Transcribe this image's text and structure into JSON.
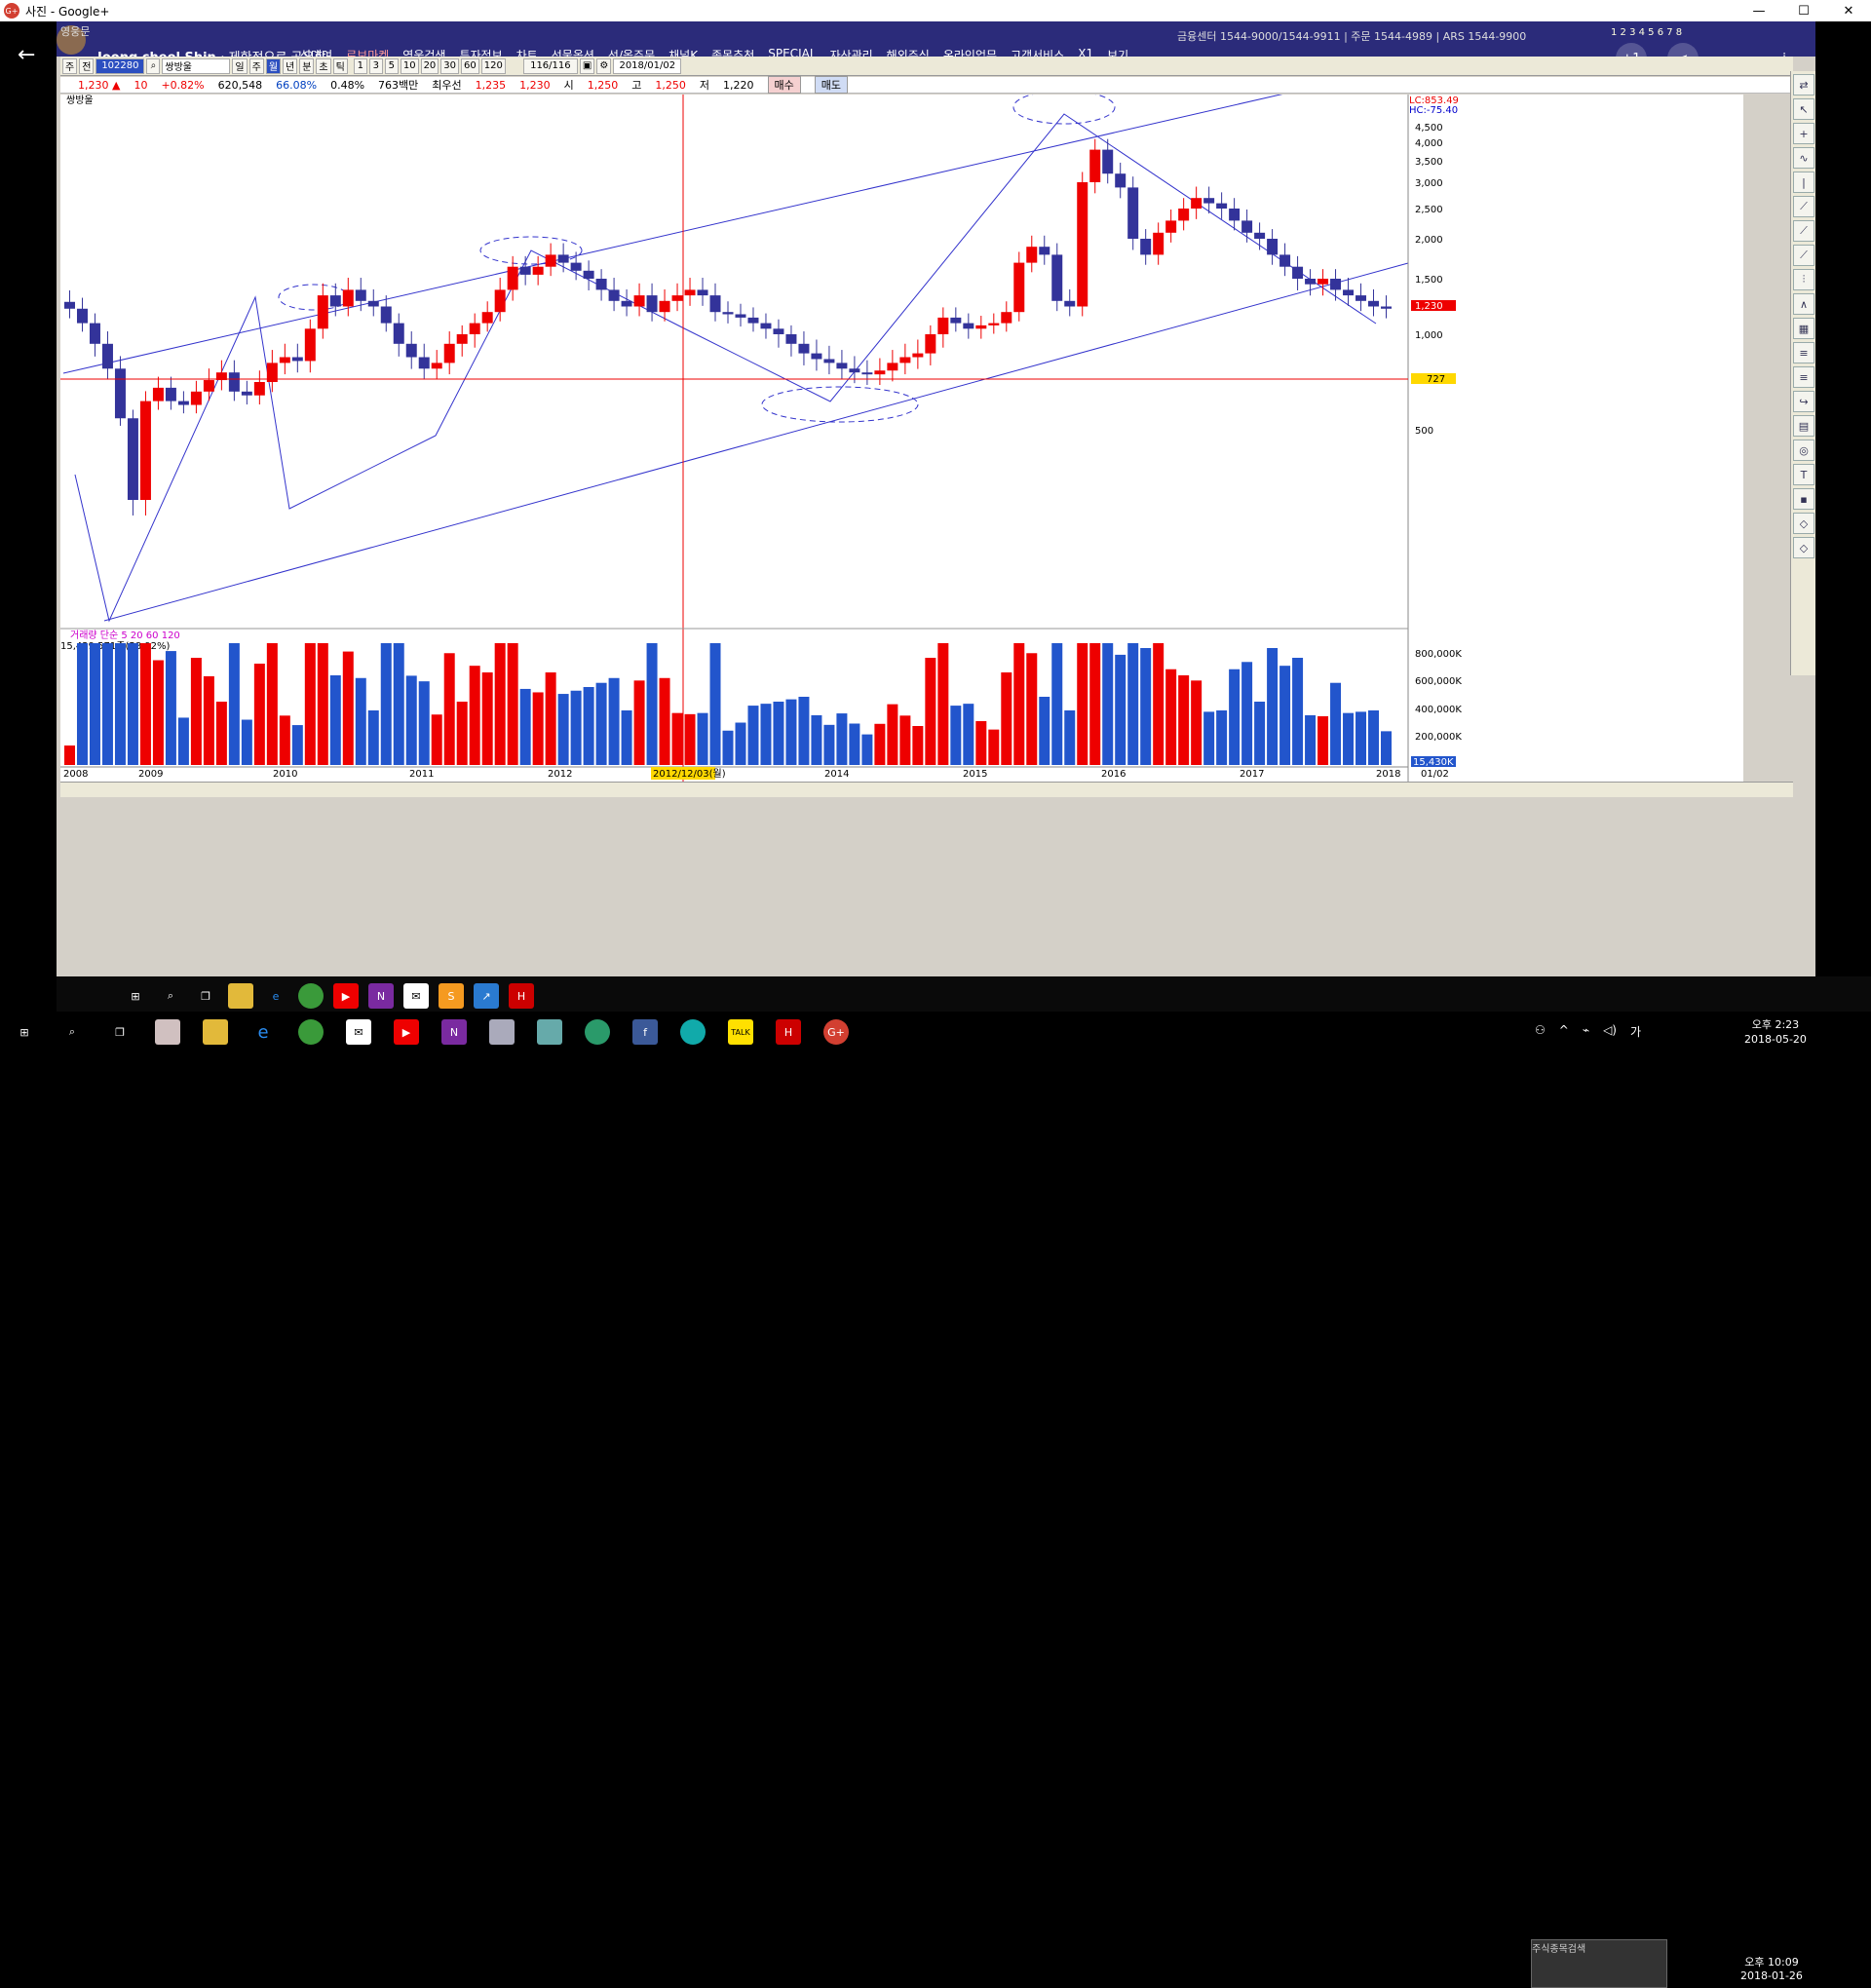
{
  "window": {
    "title": "사진 - Google+",
    "icon": "google-plus-icon",
    "minimize": "—",
    "maximize": "☐",
    "close": "✕"
  },
  "post": {
    "owner": "영웅문",
    "author": "Joong cheol Shin",
    "caption": "· 제한적으로 공유함",
    "plus_one": "+1",
    "share": "share-icon",
    "zoom": "zoom-icon",
    "info": "i"
  },
  "hts": {
    "menus": [
      "식대여",
      "로보마켓",
      "영웅검색",
      "투자정보",
      "차트",
      "선물옵션",
      "선/옵주문",
      "채널K",
      "종목추천",
      "SPECIAL",
      "자산관리",
      "해외주식",
      "온라인업무",
      "고객서비스",
      "X1",
      "보기"
    ],
    "hotline": "금융센터 1544-9000/1544-9911  |  주문 1544-4989  |  ARS 1544-9900",
    "window_numbers": "1 2 3 4 5 6 7 8",
    "toolbar": {
      "type": "주",
      "sel": "전",
      "code": "102280",
      "name": "쌍방울",
      "periods": [
        "일",
        "주",
        "월",
        "년",
        "분",
        "초",
        "틱"
      ],
      "active_period": "월",
      "intervals": [
        "1",
        "3",
        "5",
        "10",
        "20",
        "30",
        "60",
        "120"
      ],
      "count": "116/116",
      "date": "2018/01/02"
    },
    "quote": {
      "price": "1,230 ▲",
      "change": "10",
      "pct": "+0.82%",
      "volume": "620,548",
      "vol_ratio": "66.08%",
      "turnover": "0.48%",
      "amount": "763백만",
      "best_ask_label": "최우선",
      "best_ask": "1,235",
      "best_bid": "1,230",
      "open_label": "시",
      "open": "1,250",
      "high_label": "고",
      "high": "1,250",
      "low_label": "저",
      "low": "1,220",
      "buy": "매수",
      "sell": "매도"
    }
  },
  "chart_data": {
    "type": "candlestick",
    "title": "쌍방울",
    "interval": "monthly",
    "y_ticks": [
      "4,500",
      "4,000",
      "3,500",
      "3,000",
      "2,500",
      "2,000",
      "1,500",
      "1,000",
      "500"
    ],
    "lc_label": "LC:853.49",
    "hc_label": "HC:-75.40",
    "current_price_label": "1,230",
    "crosshair_price_label": "727",
    "x_ticks": [
      "2008",
      "2009",
      "2010",
      "2011",
      "2012",
      "2013",
      "2014",
      "2015",
      "2016",
      "2017",
      "2018",
      "01/02"
    ],
    "crosshair_date": "2012/12/03(월)",
    "candles_close": [
      1230,
      1100,
      950,
      820,
      560,
      380,
      650,
      720,
      650,
      630,
      700,
      760,
      800,
      700,
      680,
      750,
      850,
      880,
      860,
      1050,
      1350,
      1250,
      1400,
      1300,
      1250,
      1100,
      950,
      880,
      820,
      850,
      950,
      1000,
      1100,
      1200,
      1400,
      1650,
      1550,
      1650,
      1800,
      1700,
      1600,
      1500,
      1400,
      1300,
      1250,
      1350,
      1200,
      1300,
      1350,
      1400,
      1350,
      1200,
      1180,
      1150,
      1100,
      1050,
      1000,
      950,
      900,
      870,
      850,
      820,
      800,
      790,
      810,
      850,
      880,
      900,
      1000,
      1150,
      1100,
      1050,
      1080,
      1100,
      1200,
      1700,
      1900,
      1800,
      1300,
      1250,
      3000,
      3800,
      3200,
      2900,
      2000,
      1800,
      2100,
      2300,
      2500,
      2700,
      2600,
      2500,
      2300,
      2100,
      2000,
      1800,
      1650,
      1500,
      1450,
      1500,
      1400,
      1350,
      1300,
      1250,
      1230
    ],
    "volume_legend": "거래량  단순 5  20  60  120",
    "volume_text": "15,429,571주(58.92%)",
    "volume_y_ticks": [
      "800,000K",
      "600,000K",
      "400,000K",
      "200,000K"
    ],
    "volume_last": "15,430K"
  },
  "taskbar_inner": {
    "time": "오후 10:09",
    "date": "2018-01-26",
    "popup": "주식종목검색"
  },
  "taskbar": {
    "time": "오후 2:23",
    "date": "2018-05-20",
    "lang": "가"
  }
}
